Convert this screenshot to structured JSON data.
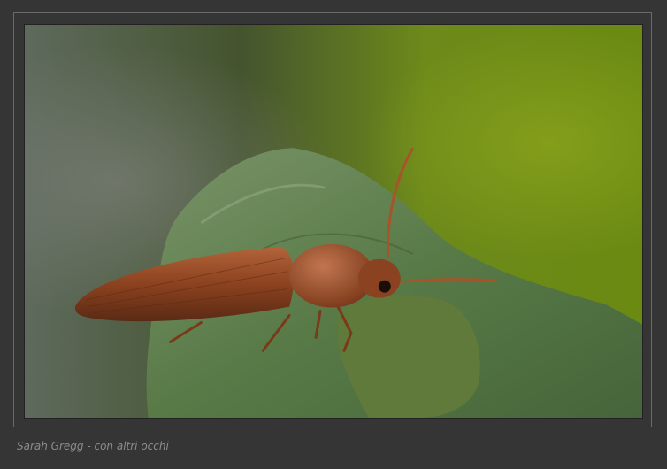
{
  "caption": "Sarah Gregg - con altri occhi",
  "colors": {
    "page_background": "#353535",
    "frame_border": "#6a6a6a",
    "caption_text": "#8c8c8c",
    "beetle_body": "#9a4a25",
    "leaf": "#5c7a4e",
    "bokeh_background": "#6a8a1e"
  },
  "photo": {
    "subject": "beetle-on-leaf"
  }
}
